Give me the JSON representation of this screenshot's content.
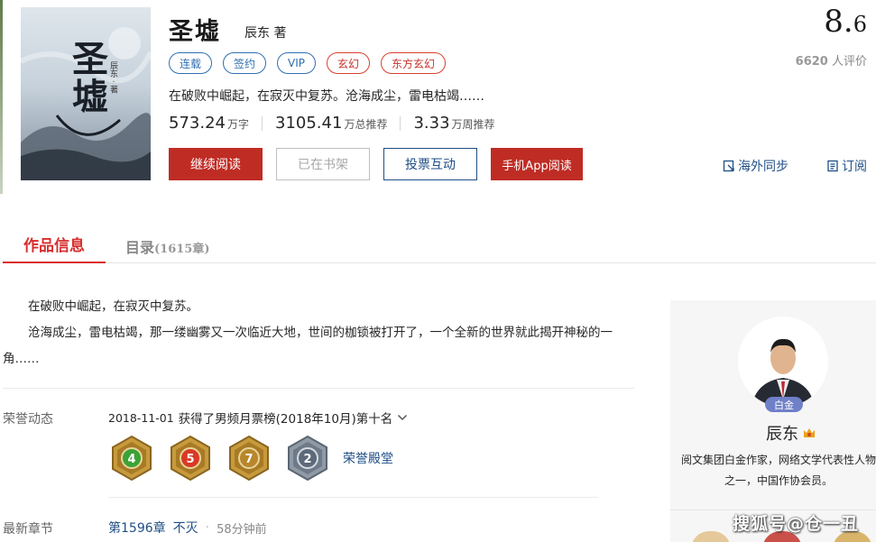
{
  "book": {
    "cover_title": "圣墟",
    "cover_author": "辰东 · 著",
    "title": "圣墟",
    "author": "辰东 著",
    "tags": [
      {
        "label": "连载",
        "color": "blue"
      },
      {
        "label": "签约",
        "color": "blue"
      },
      {
        "label": "VIP",
        "color": "blue"
      },
      {
        "label": "玄幻",
        "color": "red"
      },
      {
        "label": "东方玄幻",
        "color": "red"
      }
    ],
    "intro_short": "在破败中崛起，在寂灭中复苏。沧海成尘，雷电枯竭……",
    "stats": [
      {
        "value": "573.24",
        "unit": "万字"
      },
      {
        "value": "3105.41",
        "unit": "万总推荐"
      },
      {
        "value": "3.33",
        "unit": "万周推荐"
      }
    ]
  },
  "buttons": {
    "continue_reading": "继续阅读",
    "in_shelf": "已在书架",
    "vote": "投票互动",
    "app_read": "手机App阅读"
  },
  "rating": {
    "score_int": "8.",
    "score_dec": "6",
    "count": "6620",
    "count_suffix": " 人评价"
  },
  "side_links": {
    "overseas": "海外同步",
    "subscribe": "订阅"
  },
  "tabs": {
    "info": "作品信息",
    "catalog": "目录",
    "catalog_count": "(1615章)"
  },
  "description": {
    "line1": "在破败中崛起，在寂灭中复苏。",
    "line2": "沧海成尘，雷电枯竭，那一缕幽雾又一次临近大地，世间的枷锁被打开了，一个全新的世界就此揭开神秘的一角……"
  },
  "honors": {
    "label": "荣誉动态",
    "date": "2018-11-01",
    "text": "获得了男频月票榜(2018年10月)第十名",
    "medals": [
      {
        "number": "4",
        "color": "#3aa335"
      },
      {
        "number": "5",
        "color": "#d83a26"
      },
      {
        "number": "7",
        "color": "#b8862b"
      },
      {
        "number": "2",
        "color": "#5d6a7a"
      }
    ],
    "hall_link": "荣誉殿堂"
  },
  "latest": {
    "label": "最新章节",
    "chapter": "第1596章",
    "chapter_title": "不灭",
    "time": "58分钟前"
  },
  "author_card": {
    "badge": "白金",
    "name": "辰东",
    "bio": "阅文集团白金作家，网络文学代表性人物之一，中国作协会员。"
  },
  "watermark": "搜狐号@仓一丑",
  "colors": {
    "brand_red": "#bf2c24",
    "link_blue": "#1f4e86",
    "tab_active": "#d82d2d"
  }
}
